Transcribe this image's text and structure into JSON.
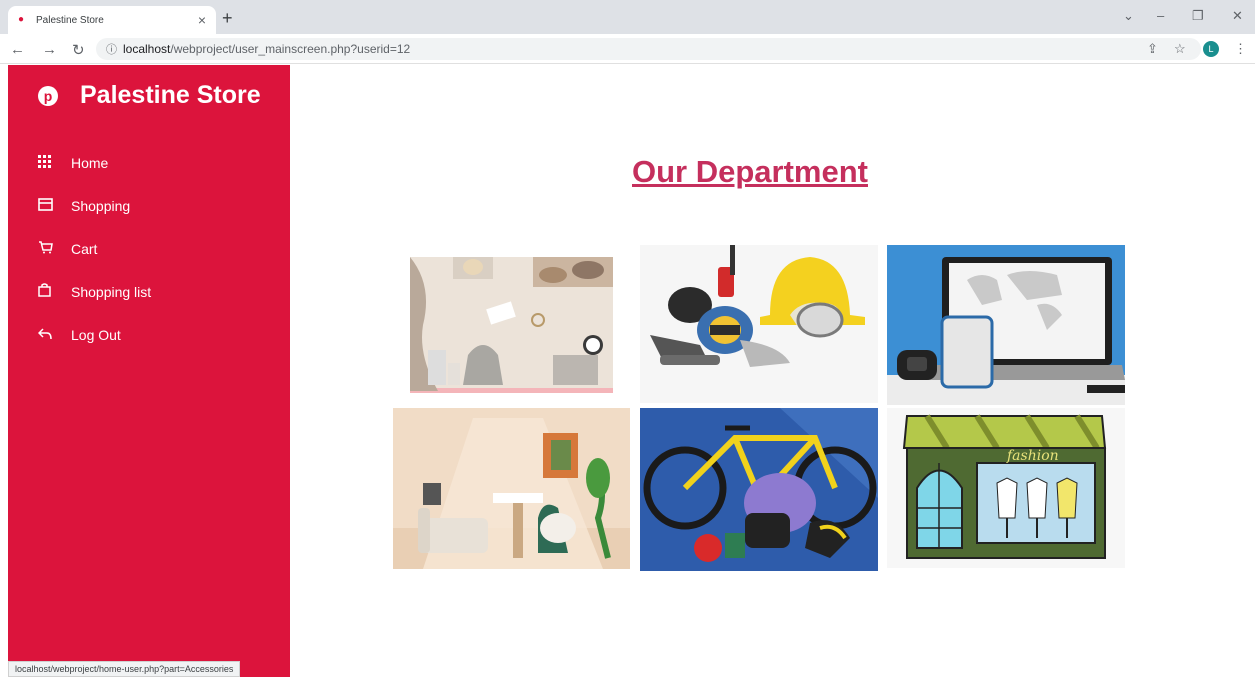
{
  "browser": {
    "tab_title": "Palestine Store",
    "tab_close": "×",
    "new_tab": "+",
    "url_host": "localhost",
    "url_path": "/webproject/user_mainscreen.php?userid=12",
    "profile_initial": "L"
  },
  "sidebar": {
    "brand": "Palestine Store",
    "items": [
      {
        "label": "Home",
        "icon": "grid-icon"
      },
      {
        "label": "Shopping",
        "icon": "store-icon"
      },
      {
        "label": "Cart",
        "icon": "cart-icon"
      },
      {
        "label": "Shopping list",
        "icon": "bag-icon"
      },
      {
        "label": "Log Out",
        "icon": "logout-icon"
      }
    ]
  },
  "main": {
    "heading": "Our Department",
    "departments": [
      {
        "image": "accessories"
      },
      {
        "image": "safety-equipment"
      },
      {
        "image": "electronics"
      },
      {
        "image": "furniture"
      },
      {
        "image": "sports"
      },
      {
        "image": "fashion-store"
      }
    ]
  },
  "status_bar": {
    "text": "localhost/webproject/home-user.php?part=Accessories"
  },
  "colors": {
    "accent": "#dc143c",
    "heading": "#c52f5d"
  }
}
